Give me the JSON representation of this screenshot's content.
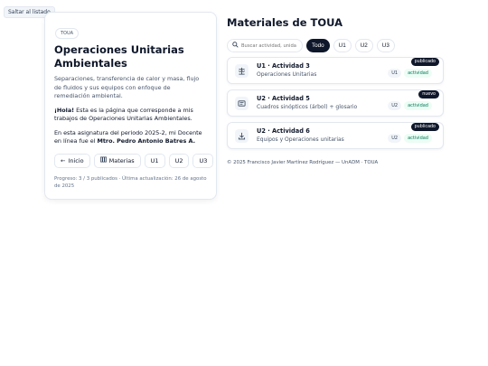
{
  "skip_link": "Saltar al listado",
  "sidebar": {
    "chip": "TOUA",
    "title": "Operaciones Unitarias Ambientales",
    "description": "Separaciones, transferencia de calor y masa, flujo de fluidos y sus equipos con enfoque de remediación ambiental.",
    "greeting_bold": "¡Hola!",
    "greeting_text": " Esta es la página que corresponde a mis trabajos de Operaciones Unitarias Ambientales.",
    "teacher_text": "En esta asignatura del periodo 2025-2, mi Docente en línea fue el ",
    "teacher_name": "Mtro. Pedro Antonio Batres A.",
    "nav": [
      {
        "label": "Inicio",
        "icon": "arrow-left-icon"
      },
      {
        "label": "Materias",
        "icon": "books-icon"
      },
      {
        "label": "U1"
      },
      {
        "label": "U2"
      },
      {
        "label": "U3"
      }
    ],
    "progress": "Progreso: 3 / 3 publicados · Última actualización: 26 de agosto de 2025"
  },
  "main": {
    "title": "Materiales de TOUA",
    "search_placeholder": "Buscar actividad, unida",
    "filters": [
      "Todo",
      "U1",
      "U2",
      "U3"
    ],
    "active_filter": "Todo",
    "items": [
      {
        "title": "U1 · Actividad 3",
        "subtitle": "Operaciones Unitarias",
        "unit": "U1",
        "kind": "actividad",
        "status": "publicado",
        "icon": "scale-icon"
      },
      {
        "title": "U2 · Actividad 5",
        "subtitle": "Cuadros sinópticos (árbol) + glosario",
        "unit": "U2",
        "kind": "actividad",
        "status": "nuevo",
        "icon": "document-icon"
      },
      {
        "title": "U2 · Actividad 6",
        "subtitle": "Equipos y Operaciones unitarias",
        "unit": "U2",
        "kind": "actividad",
        "status": "publicado",
        "icon": "download-icon"
      }
    ],
    "footer": "© 2025 Francisco Javier Martínez Rodríguez — UnADM · TOUA"
  },
  "colors": {
    "accent": "#0f172a",
    "kind_green": "#047857",
    "border": "#e2e8f0"
  }
}
